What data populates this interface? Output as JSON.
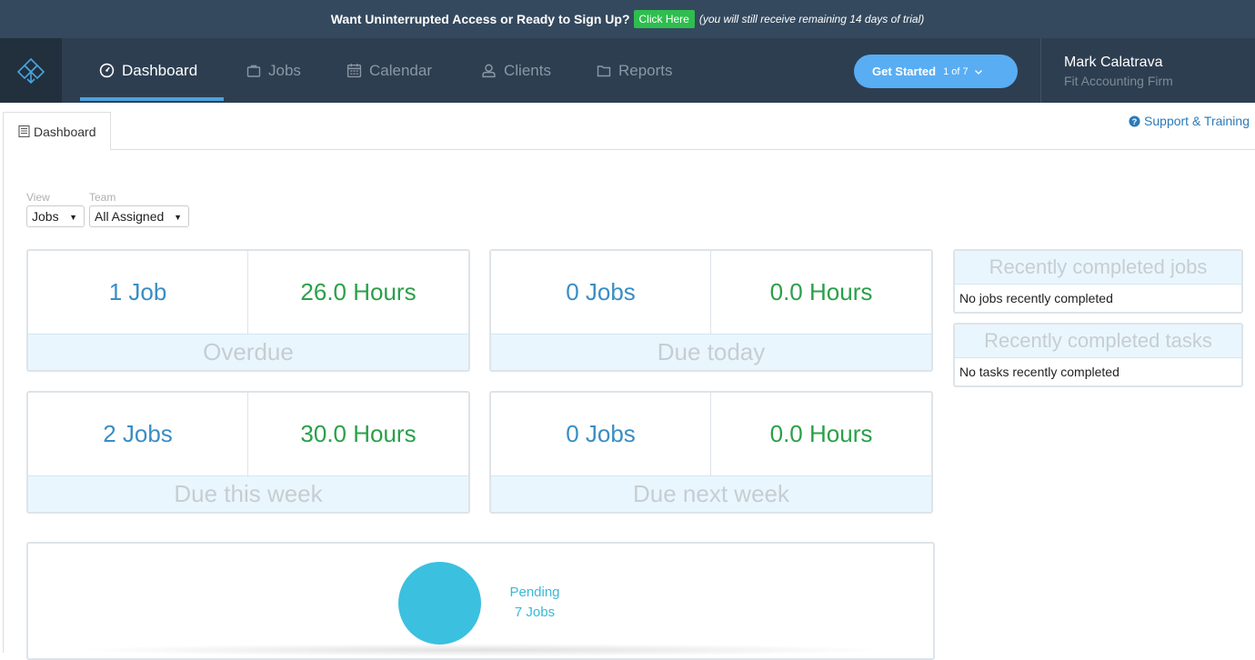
{
  "banner": {
    "message": "Want Uninterrupted Access or Ready to Sign Up?",
    "cta_label": "Click Here",
    "note": "(you will still receive remaining 14 days of trial)"
  },
  "nav": {
    "items": [
      {
        "label": "Dashboard",
        "icon": "dashboard-gauge-icon",
        "active": true
      },
      {
        "label": "Jobs",
        "icon": "briefcase-icon",
        "active": false
      },
      {
        "label": "Calendar",
        "icon": "calendar-icon",
        "active": false
      },
      {
        "label": "Clients",
        "icon": "user-icon",
        "active": false
      },
      {
        "label": "Reports",
        "icon": "folder-icon",
        "active": false
      }
    ],
    "get_started": {
      "label": "Get Started",
      "step": "1 of 7"
    },
    "user": {
      "name": "Mark Calatrava",
      "firm": "Fit Accounting Firm"
    }
  },
  "tabs": {
    "active_label": "Dashboard"
  },
  "support_label": "Support & Training",
  "filters": {
    "view": {
      "label": "View",
      "value": "Jobs"
    },
    "team": {
      "label": "Team",
      "value": "All Assigned"
    }
  },
  "stats": [
    {
      "jobs": "1 Job",
      "hours": "26.0 Hours",
      "label": "Overdue"
    },
    {
      "jobs": "0 Jobs",
      "hours": "0.0 Hours",
      "label": "Due today"
    },
    {
      "jobs": "2 Jobs",
      "hours": "30.0 Hours",
      "label": "Due this week"
    },
    {
      "jobs": "0 Jobs",
      "hours": "0.0 Hours",
      "label": "Due next week"
    }
  ],
  "recent": {
    "jobs": {
      "title": "Recently completed jobs",
      "empty": "No jobs recently completed"
    },
    "tasks": {
      "title": "Recently completed tasks",
      "empty": "No tasks recently completed"
    }
  },
  "status_chart": {
    "segments": [
      {
        "status": "Pending",
        "count": "7 Jobs",
        "color": "#3bc0e0"
      }
    ]
  },
  "colors": {
    "banner_bg": "#34495e",
    "nav_bg": "#2d3e50",
    "cta_green": "#2ebd4e",
    "accent_blue": "#59adf3",
    "jobs_blue": "#3a8dc4",
    "hours_green": "#2aa049"
  }
}
